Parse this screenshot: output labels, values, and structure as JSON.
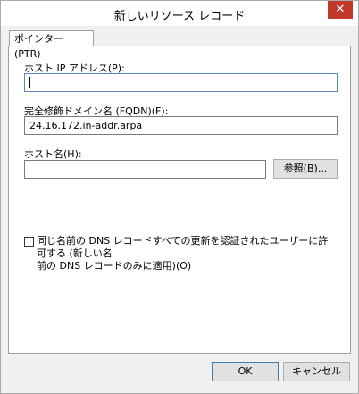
{
  "window": {
    "title": "新しいリソース レコード"
  },
  "tabs": [
    {
      "label": "ポインター (PTR)"
    }
  ],
  "fields": {
    "host_ip_label": "ホスト IP アドレス(P):",
    "host_ip_value": "",
    "fqdn_label": "完全修飾ドメイン名 (FQDN)(F):",
    "fqdn_value": "24.16.172.in-addr.arpa",
    "host_name_label": "ホスト名(H):",
    "host_name_value": ""
  },
  "buttons": {
    "browse": "参照(B)...",
    "ok": "OK",
    "cancel": "キャンセル"
  },
  "checkbox": {
    "line1": "同じ名前の DNS レコードすべての更新を認証されたユーザーに許可する (新しい名",
    "line2": "前の DNS レコードのみに適用)(O)",
    "checked": false
  },
  "icons": {
    "close": "close-icon"
  }
}
